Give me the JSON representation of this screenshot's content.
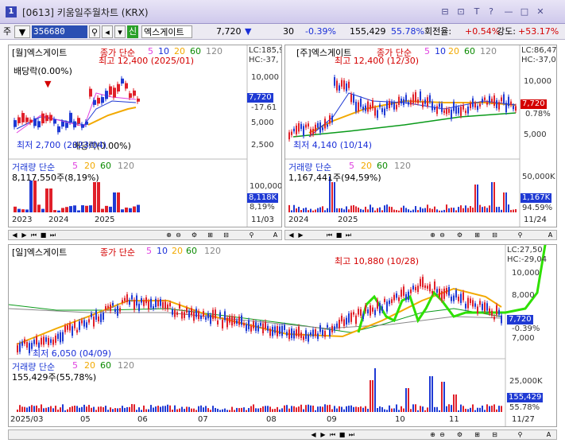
{
  "window": {
    "number": "1",
    "title": "[0613] 키움일주월차트 (KRX)",
    "controls": [
      "⊟",
      "⊡",
      "T",
      "?",
      "—",
      "□",
      "✕"
    ]
  },
  "toolbar": {
    "market": "주",
    "code": "356680",
    "new_badge": "신",
    "name": "엑스게이트",
    "price": "7,720",
    "change": "30",
    "change_pct": "-0.39%",
    "volume": "155,429",
    "volume_pct": "55.78%",
    "turnover_label": "회전율:",
    "turnover": "+0.54%",
    "strength_label": "강도:",
    "strength": "+53.17%"
  },
  "monthly": {
    "header": "[월]엑스게이트",
    "ma_label": "종가 단순",
    "ma": [
      "5",
      "10",
      "20",
      "60",
      "120"
    ],
    "lc": "LC:185,9",
    "hc": "HC:-37,",
    "high_label": "최고 12,400 (2025/01)",
    "low_label": "최저 2,700 (2023/04)",
    "div_top": "배당락(0.00%)",
    "div_bottom": "배당락(0.00%)",
    "yaxis": [
      "10,000",
      "7,720",
      "-17.61",
      "5,000",
      "2,500"
    ],
    "vol_header": "거래량 단순",
    "vol_ma": [
      "5",
      "20",
      "60",
      "120"
    ],
    "vol_value": "8,117,550주(8,19%)",
    "vol_axis": [
      "100,000",
      "8,118K",
      "8,19%"
    ],
    "dates": [
      "2023",
      "2024",
      "2025",
      "11/03"
    ]
  },
  "weekly": {
    "header": "[주]엑스게이트",
    "ma_label": "종가 단순",
    "ma": [
      "5",
      "10",
      "20",
      "60",
      "120"
    ],
    "lc": "LC:86,47",
    "hc": "HC:-37,0",
    "high_label": "최고 12,400 (12/30)",
    "low_label": "최저 4,140 (10/14)",
    "yaxis": [
      "10,000",
      "7,720",
      "0.78%",
      "5,000"
    ],
    "vol_header": "거래량 단순",
    "vol_ma": [
      "5",
      "20",
      "60",
      "120"
    ],
    "vol_value": "1,167,441주(94,59%)",
    "vol_axis": [
      "50,000K",
      "1,167K",
      "94.59%"
    ],
    "dates": [
      "2024",
      "2025",
      "11/24"
    ]
  },
  "daily": {
    "header": "[일]엑스게이트",
    "ma_label": "종가 단순",
    "ma": [
      "5",
      "10",
      "20",
      "60",
      "120"
    ],
    "lc": "LC:27,50",
    "hc": "HC:-29,04",
    "high_label": "최고 10,880 (10/28)",
    "low_label": "최저 6,050 (04/09)",
    "yaxis": [
      "10,000",
      "8,000",
      "7,720",
      "-0.39%",
      "7,000"
    ],
    "vol_header": "거래량 단순",
    "vol_ma": [
      "5",
      "20",
      "60",
      "120"
    ],
    "vol_value": "155,429주(55,78%)",
    "vol_axis": [
      "25,000K",
      "155,429",
      "55.78%"
    ],
    "dates": [
      "2025/03",
      "05",
      "06",
      "07",
      "08",
      "09",
      "10",
      "11",
      "11/27"
    ]
  },
  "colors": {
    "up": "#e0202a",
    "down": "#1f3ad4",
    "ma5": "#e040e0",
    "ma10": "#1f3ad4",
    "ma20": "#f2a900",
    "ma60": "#0a9a1a",
    "ma120": "#888888",
    "annotation": "#2ee000"
  },
  "scroll_icons": [
    "◀",
    "▶",
    "⏮",
    "■",
    "⏭",
    "⊕",
    "⊖",
    "⚙",
    "⊞",
    "⊟",
    "⚲",
    "A"
  ]
}
